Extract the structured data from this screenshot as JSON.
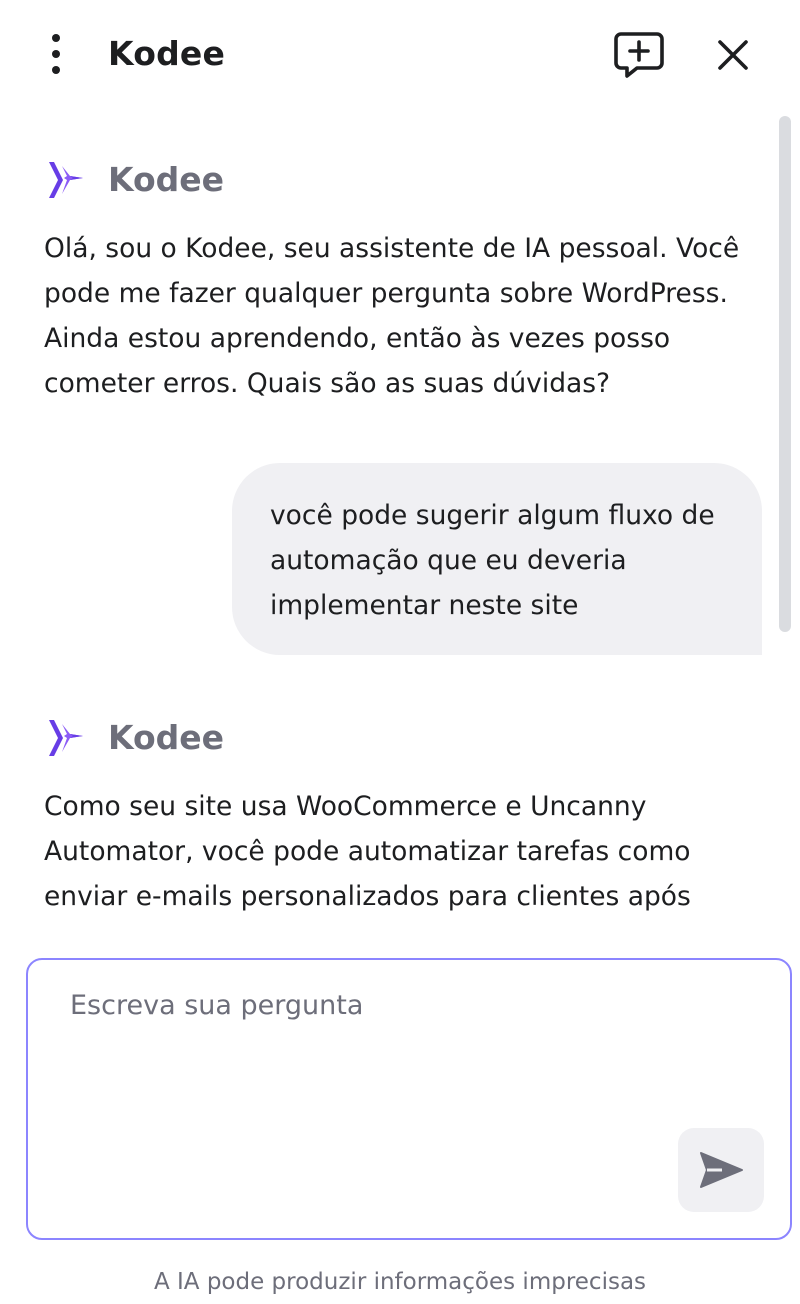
{
  "header": {
    "title": "Kodee",
    "menu_icon": "vertical-dots-icon",
    "new_chat_icon": "new-chat-plus-icon",
    "close_icon": "close-icon"
  },
  "bot": {
    "name": "Kodee",
    "logo_icon": "kodee-logo-icon",
    "brand_color": "#673de6"
  },
  "messages": [
    {
      "sender": "bot",
      "sender_name": "Kodee",
      "text": "Olá, sou o Kodee, seu assistente de IA pessoal. Você pode me fazer qualquer pergunta sobre WordPress. Ainda estou aprendendo, então às vezes posso cometer erros. Quais são as suas dúvidas?"
    },
    {
      "sender": "user",
      "text": "você pode sugerir algum fluxo de automação que eu deveria implementar neste site"
    },
    {
      "sender": "bot",
      "sender_name": "Kodee",
      "text": "Como seu site usa WooCommerce e Uncanny Automator, você pode automatizar tarefas como enviar e-mails personalizados para clientes após"
    }
  ],
  "composer": {
    "placeholder": "Escreva sua pergunta",
    "value": "",
    "send_icon": "send-icon"
  },
  "disclaimer": "A IA pode produzir informações imprecisas",
  "colors": {
    "accent_border": "#8c85ff",
    "user_bubble_bg": "#f0f0f3",
    "muted_text": "#6d6e7a"
  }
}
